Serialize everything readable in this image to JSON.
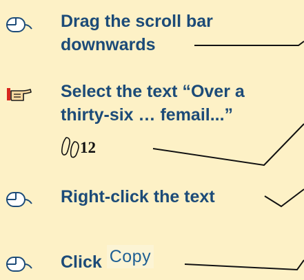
{
  "steps": [
    {
      "icon": "mouse-icon",
      "lines": [
        "Drag the scroll bar",
        "downwards"
      ]
    },
    {
      "icon": "pointing-hand-icon",
      "lines": [
        "Select the text “Over a",
        "thirty-six … femail...”"
      ],
      "badge": "12",
      "badge_icon": "footprints-icon"
    },
    {
      "icon": "mouse-icon",
      "lines": [
        "Right-click the text"
      ]
    },
    {
      "icon": "mouse-icon",
      "prefix": "Click",
      "button_label": "Copy"
    }
  ],
  "colors": {
    "background": "#fdf1c6",
    "text": "#1c4b78",
    "hand_accent": "#d7261e"
  }
}
